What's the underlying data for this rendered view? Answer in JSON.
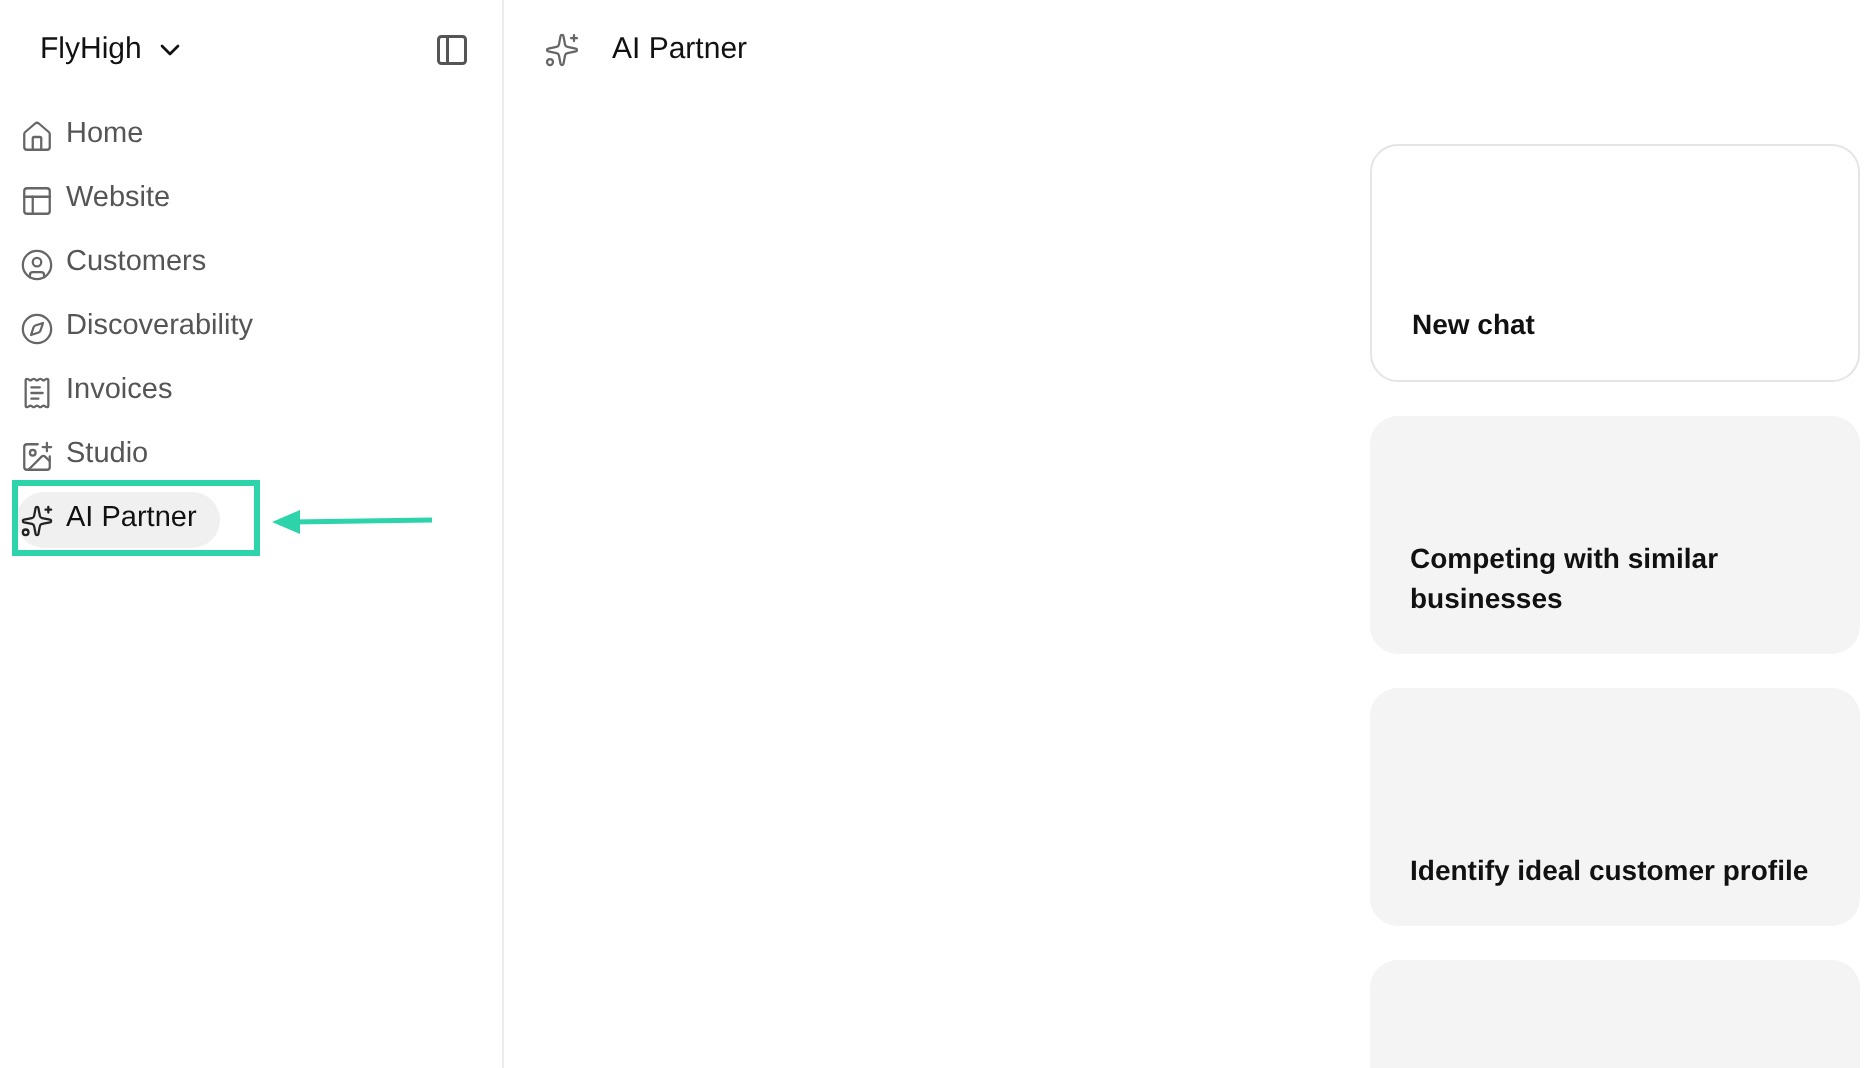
{
  "workspace": {
    "name": "FlyHigh"
  },
  "sidebar": {
    "items": [
      {
        "label": "Home",
        "selected": false,
        "annotated": false
      },
      {
        "label": "Website",
        "selected": false,
        "annotated": false
      },
      {
        "label": "Customers",
        "selected": false,
        "annotated": false
      },
      {
        "label": "Discoverability",
        "selected": false,
        "annotated": false
      },
      {
        "label": "Invoices",
        "selected": false,
        "annotated": false
      },
      {
        "label": "Studio",
        "selected": false,
        "annotated": false
      },
      {
        "label": "AI Partner",
        "selected": true,
        "annotated": true
      }
    ]
  },
  "header": {
    "title": "AI Partner"
  },
  "cards": [
    {
      "kind": "outline",
      "title": "New chat"
    },
    {
      "kind": "filled",
      "title": "Competing with similar businesses"
    },
    {
      "kind": "filled",
      "title": "Identify ideal customer profile"
    },
    {
      "kind": "filled"
    }
  ]
}
